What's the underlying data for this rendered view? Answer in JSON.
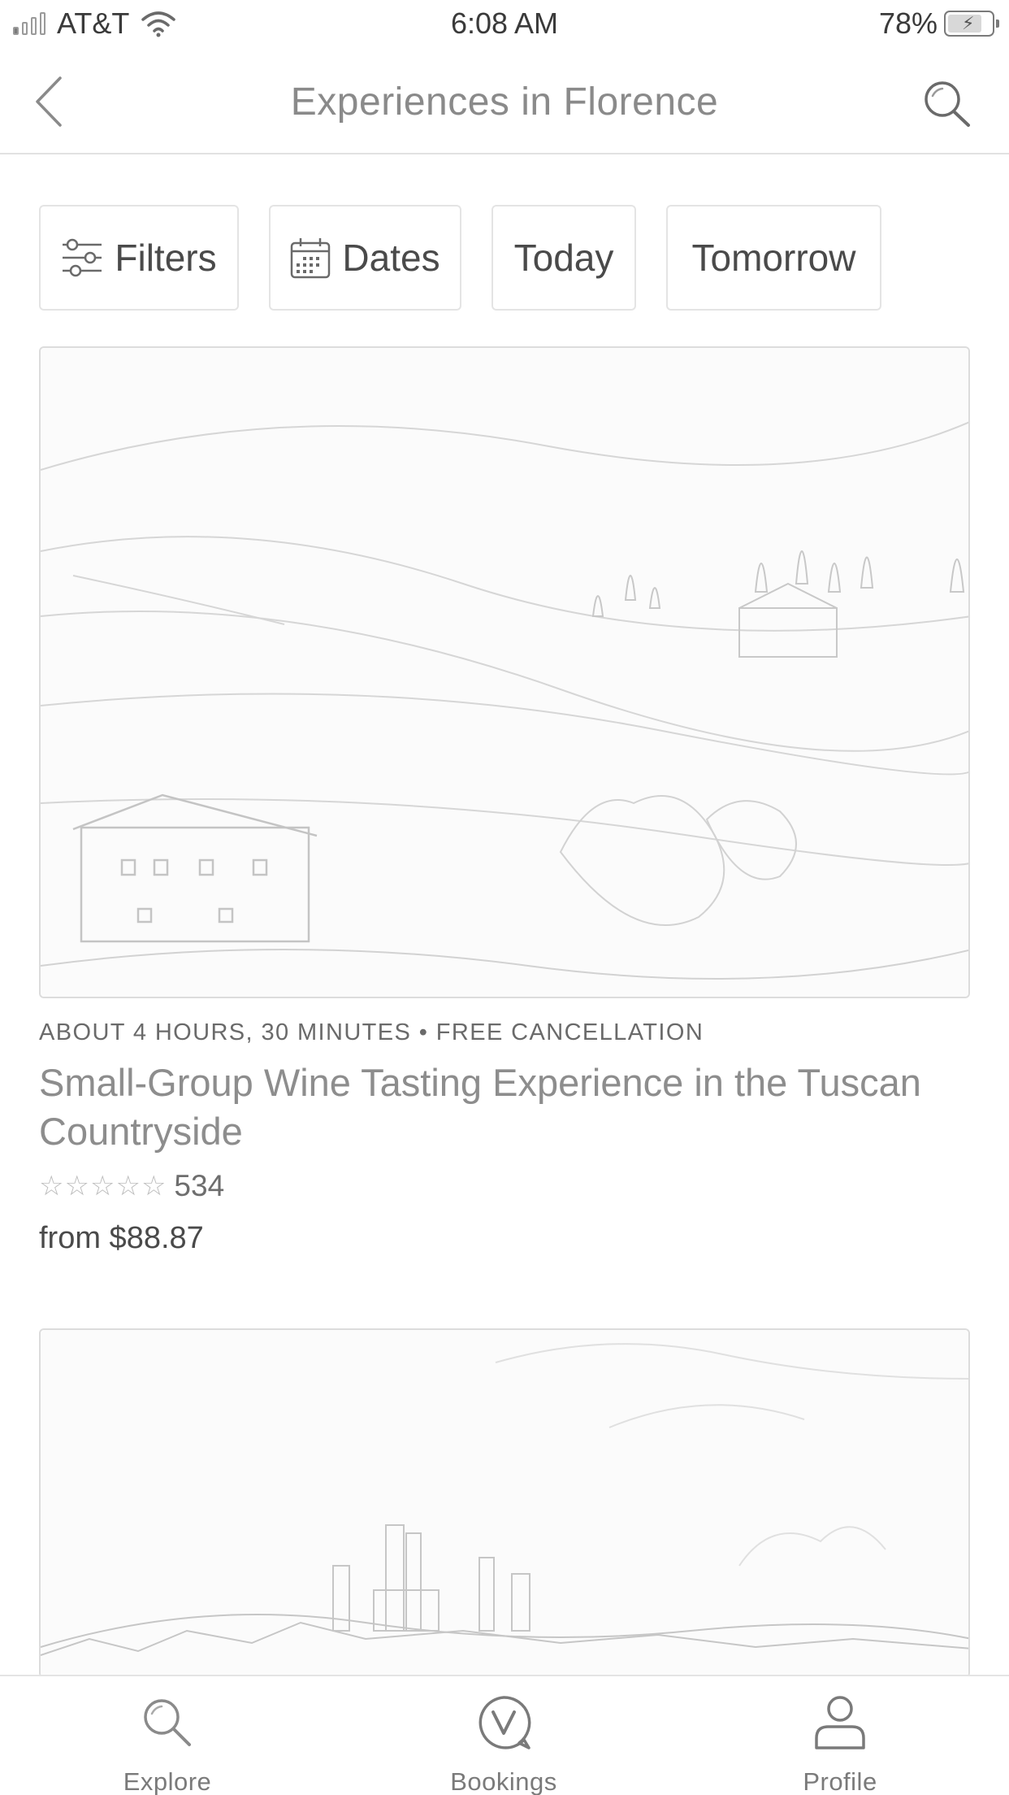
{
  "status_bar": {
    "carrier": "AT&T",
    "time": "6:08 AM",
    "battery_percent": "78%",
    "battery_level": 0.78,
    "icons": [
      "signal-icon",
      "wifi-icon",
      "battery-charging-icon"
    ]
  },
  "nav": {
    "title": "Experiences in Florence",
    "back_icon": "chevron-left-icon",
    "search_icon": "search-icon"
  },
  "filters": {
    "chips": [
      {
        "label": "Filters",
        "icon": "sliders-icon"
      },
      {
        "label": "Dates",
        "icon": "calendar-icon"
      },
      {
        "label": "Today"
      },
      {
        "label": "Tomorrow"
      }
    ]
  },
  "listings": [
    {
      "image": "tuscan-countryside-photo",
      "meta": "ABOUT 4 HOURS, 30 MINUTES • FREE CANCELLATION",
      "title": "Small-Group Wine Tasting Experience in the Tuscan Countryside",
      "rating_stars": 0,
      "review_count": "534",
      "price": "from $88.87"
    },
    {
      "image": "hill-town-skyline-photo"
    }
  ],
  "tab_bar": {
    "tabs": [
      {
        "label": "Explore",
        "icon": "search-icon"
      },
      {
        "label": "Bookings",
        "icon": "bookings-v-icon"
      },
      {
        "label": "Profile",
        "icon": "person-icon"
      }
    ]
  },
  "colors": {
    "text_dark": "#4a4a4a",
    "text_muted": "#8d8d8d",
    "border": "#e4e4e4",
    "background": "#ffffff"
  }
}
